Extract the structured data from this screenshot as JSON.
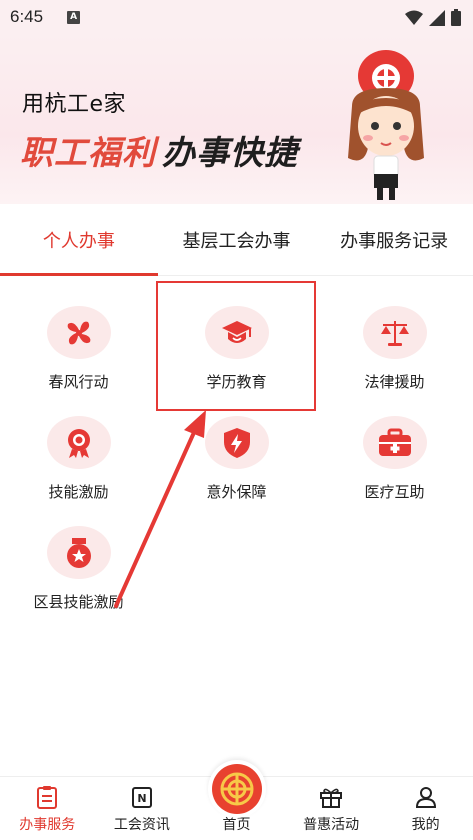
{
  "status_bar": {
    "time": "6:45",
    "notification_letter": "A"
  },
  "banner": {
    "subtitle": "用杭工e家",
    "title_red": "职工福利",
    "title_dark": "办事快捷",
    "colors": {
      "red": "#e14a3c",
      "bg": "#fbeff1"
    }
  },
  "tabs": [
    {
      "label": "个人办事",
      "active": true
    },
    {
      "label": "基层工会办事",
      "active": false
    },
    {
      "label": "办事服务记录",
      "active": false
    }
  ],
  "services": [
    {
      "label": "春风行动",
      "icon": "pinwheel-icon"
    },
    {
      "label": "学历教育",
      "icon": "graduation-cap-icon"
    },
    {
      "label": "法律援助",
      "icon": "scales-icon"
    },
    {
      "label": "技能激励",
      "icon": "rosette-icon"
    },
    {
      "label": "意外保障",
      "icon": "shield-lightning-icon"
    },
    {
      "label": "医疗互助",
      "icon": "medical-kit-icon"
    },
    {
      "label": "区县技能激励",
      "icon": "medal-icon"
    }
  ],
  "bottom_nav": [
    {
      "label": "办事服务",
      "icon": "clipboard-icon",
      "active": true
    },
    {
      "label": "工会资讯",
      "icon": "news-icon",
      "active": false
    },
    {
      "label": "首页",
      "icon": "union-logo-icon",
      "active": false
    },
    {
      "label": "普惠活动",
      "icon": "gift-icon",
      "active": false
    },
    {
      "label": "我的",
      "icon": "user-icon",
      "active": false
    }
  ],
  "accent_color": "#e0392f",
  "annotation_color": "#e53935"
}
